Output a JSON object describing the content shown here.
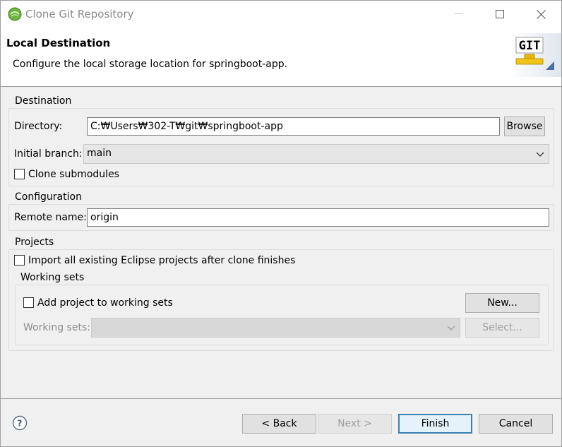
{
  "window": {
    "title": "Clone Git Repository"
  },
  "header": {
    "title": "Local Destination",
    "description": "Configure the local storage location for springboot-app.",
    "logo_text": "GIT"
  },
  "destination": {
    "group_label": "Destination",
    "directory_label": "Directory:",
    "directory_value": "C:₩Users₩302-T₩git₩springboot-app",
    "browse_label": "Browse",
    "branch_label": "Initial branch:",
    "branch_value": "main",
    "submodules_label": "Clone submodules",
    "submodules_checked": false
  },
  "configuration": {
    "group_label": "Configuration",
    "remote_label": "Remote name:",
    "remote_value": "origin"
  },
  "projects": {
    "group_label": "Projects",
    "import_label": "Import all existing Eclipse projects after clone finishes",
    "import_checked": false,
    "working_sets": {
      "group_label": "Working sets",
      "add_label": "Add project to working sets",
      "add_checked": false,
      "new_label": "New...",
      "sets_label": "Working sets:",
      "select_label": "Select..."
    }
  },
  "footer": {
    "back_label": "< Back",
    "next_label": "Next >",
    "finish_label": "Finish",
    "cancel_label": "Cancel"
  },
  "colors": {
    "accent": "#3c7fb1",
    "title_text": "#8c8c8c"
  }
}
